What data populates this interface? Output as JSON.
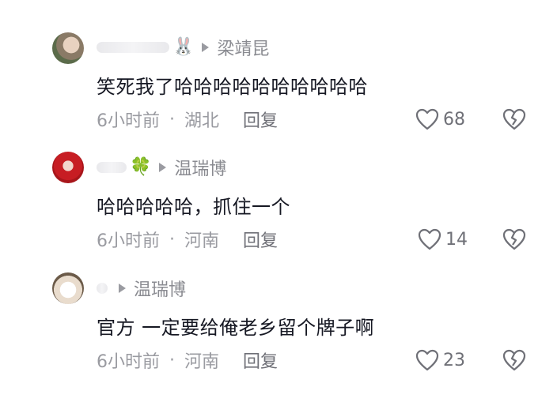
{
  "comments": [
    {
      "avatar_icon": "user-avatar-photo",
      "name_decoration": "🐰",
      "reply_to": "梁靖昆",
      "text": "笑死我了哈哈哈哈哈哈哈哈哈哈",
      "time": "6小时前",
      "separator": "·",
      "location": "湖北",
      "reply_label": "回复",
      "likes": "68"
    },
    {
      "avatar_icon": "user-avatar-photo",
      "name_decoration": "🍀",
      "reply_to": "温瑞博",
      "text": "哈哈哈哈哈，抓住一个",
      "time": "6小时前",
      "separator": "·",
      "location": "河南",
      "reply_label": "回复",
      "likes": "14"
    },
    {
      "avatar_icon": "user-avatar-photo",
      "name_decoration": "",
      "reply_to": "温瑞博",
      "text": "官方 一定要给俺老乡留个牌子啊",
      "time": "6小时前",
      "separator": "·",
      "location": "河南",
      "reply_label": "回复",
      "likes": "23"
    }
  ],
  "icons": {
    "like": "heart-outline-icon",
    "dislike": "broken-heart-icon",
    "reply_arrow": "play-arrow-icon"
  },
  "colors": {
    "text": "#161823",
    "muted": "#9a9ba1"
  }
}
